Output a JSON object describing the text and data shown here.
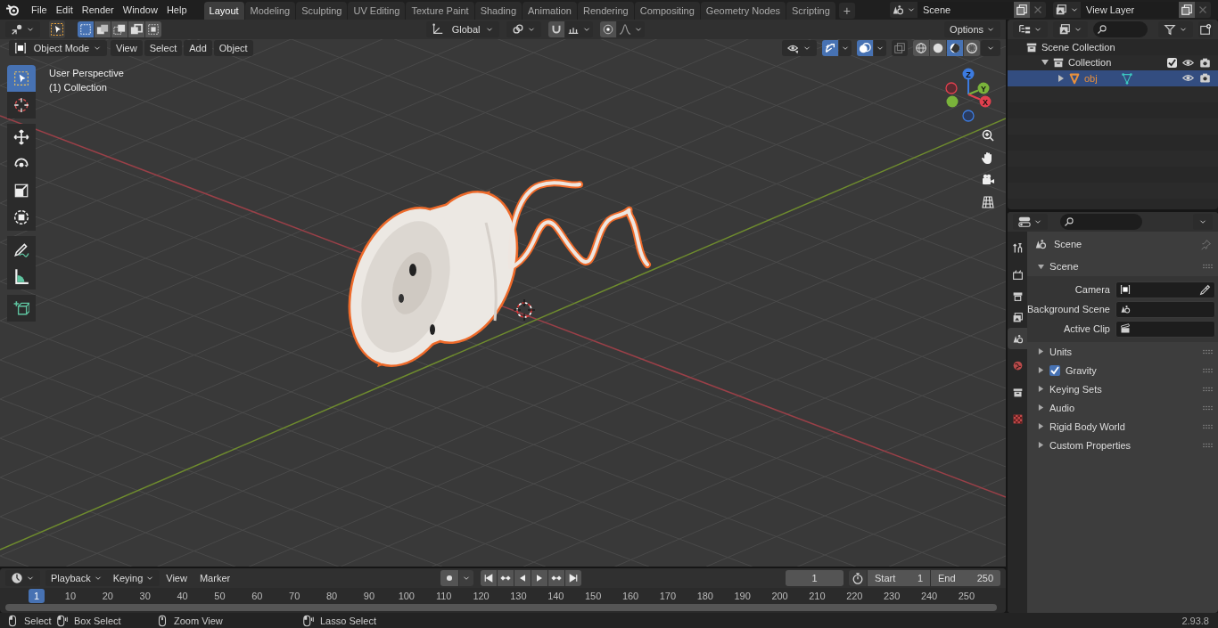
{
  "menu": [
    "File",
    "Edit",
    "Render",
    "Window",
    "Help"
  ],
  "workspaces": [
    {
      "label": "Layout",
      "selected": true
    },
    {
      "label": "Modeling",
      "selected": false
    },
    {
      "label": "Sculpting",
      "selected": false
    },
    {
      "label": "UV Editing",
      "selected": false
    },
    {
      "label": "Texture Paint",
      "selected": false
    },
    {
      "label": "Shading",
      "selected": false
    },
    {
      "label": "Animation",
      "selected": false
    },
    {
      "label": "Rendering",
      "selected": false
    },
    {
      "label": "Compositing",
      "selected": false
    },
    {
      "label": "Geometry Nodes",
      "selected": false
    },
    {
      "label": "Scripting",
      "selected": false
    }
  ],
  "add_workspace_label": "+",
  "scene_selector": {
    "value": "Scene"
  },
  "view_layer_selector": {
    "value": "View Layer"
  },
  "viewport": {
    "select_modes": [
      {
        "selected": true
      },
      {
        "selected": false
      },
      {
        "selected": false
      },
      {
        "selected": false
      },
      {
        "selected": false
      }
    ],
    "orientation": "Global",
    "options": "Options",
    "mode": "Object Mode",
    "menus": [
      "View",
      "Select",
      "Add",
      "Object"
    ],
    "shading": [
      {
        "kind": "wireframe",
        "selected": false
      },
      {
        "kind": "solid",
        "selected": false
      },
      {
        "kind": "material",
        "selected": true
      },
      {
        "kind": "rendered",
        "selected": false
      }
    ],
    "overlay_text": [
      "User Perspective",
      "(1) Collection"
    ],
    "tools": [
      {
        "kind": "select",
        "selected": true
      },
      {
        "kind": "cursor",
        "selected": false
      },
      {
        "kind": "move",
        "selected": false
      },
      {
        "kind": "rotate",
        "selected": false
      },
      {
        "kind": "scale",
        "selected": false
      },
      {
        "kind": "transform",
        "selected": false
      },
      {
        "kind": "annotate",
        "selected": false
      },
      {
        "kind": "measure",
        "selected": false
      },
      {
        "kind": "add-cube",
        "selected": false
      }
    ],
    "gizmo_labels": [
      "Z",
      "Y",
      "X"
    ]
  },
  "outliner": {
    "items": [
      {
        "label": "Scene Collection",
        "kind": "scene",
        "children": [
          {
            "label": "Collection",
            "kind": "collection",
            "expanded": true,
            "checked": true,
            "selected": false,
            "children": [
              {
                "label": "obj",
                "kind": "object",
                "expanded": false,
                "selected": true
              }
            ]
          }
        ]
      }
    ]
  },
  "properties": {
    "tabs": [
      {
        "kind": "tool",
        "selected": false
      },
      {
        "kind": "render",
        "selected": false
      },
      {
        "kind": "output",
        "selected": false
      },
      {
        "kind": "view-layer",
        "selected": false
      },
      {
        "kind": "scene",
        "selected": true
      },
      {
        "kind": "world",
        "selected": false
      },
      {
        "kind": "collection",
        "selected": false
      },
      {
        "kind": "texture",
        "selected": false
      }
    ],
    "context": "Scene",
    "panel": {
      "title": "Scene",
      "expanded": true,
      "fields": [
        {
          "label": "Camera",
          "kind": "camera"
        },
        {
          "label": "Background Scene",
          "kind": "scene"
        },
        {
          "label": "Active Clip",
          "kind": "clip"
        }
      ]
    },
    "sections": [
      {
        "label": "Units",
        "kind": "plain",
        "expanded": false
      },
      {
        "label": "Gravity",
        "kind": "checkbox",
        "checked": true,
        "expanded": false
      },
      {
        "label": "Keying Sets",
        "kind": "plain",
        "expanded": false
      },
      {
        "label": "Audio",
        "kind": "plain",
        "expanded": false
      },
      {
        "label": "Rigid Body World",
        "kind": "plain",
        "expanded": false
      },
      {
        "label": "Custom Properties",
        "kind": "plain",
        "expanded": false
      }
    ]
  },
  "timeline": {
    "menus": [
      {
        "label": "Playback",
        "kind": "dropdown"
      },
      {
        "label": "Keying",
        "kind": "dropdown"
      },
      {
        "label": "View",
        "kind": "menu"
      },
      {
        "label": "Marker",
        "kind": "menu"
      }
    ],
    "current_frame": "1",
    "start_label": "Start",
    "start": "1",
    "end_label": "End",
    "end": "250",
    "playhead": "1",
    "ruler": [
      "10",
      "20",
      "30",
      "40",
      "50",
      "60",
      "70",
      "80",
      "90",
      "100",
      "110",
      "120",
      "130",
      "140",
      "150",
      "160",
      "170",
      "180",
      "190",
      "200",
      "210",
      "220",
      "230",
      "240",
      "250"
    ]
  },
  "status_bar": {
    "hints": [
      {
        "label": "Select",
        "kind": "click"
      },
      {
        "label": "Box Select",
        "kind": "drag"
      },
      {
        "label": "Zoom View",
        "kind": "middle"
      },
      {
        "label": "Lasso Select",
        "kind": "drag"
      }
    ],
    "version": "2.93.8"
  }
}
